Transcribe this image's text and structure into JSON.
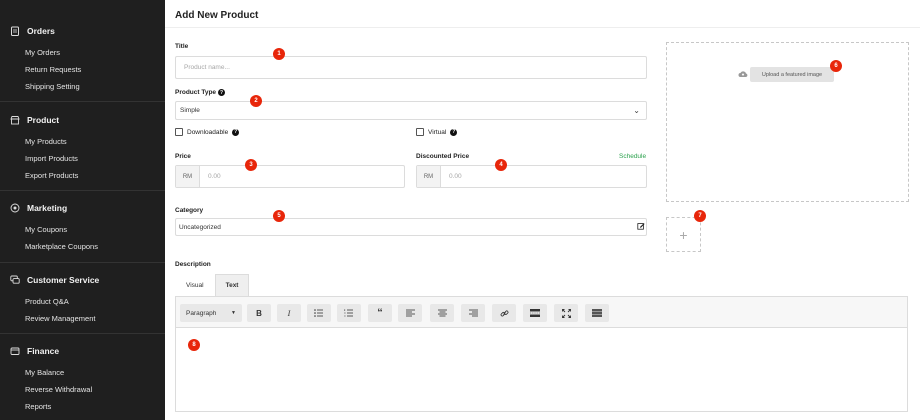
{
  "sidebar": {
    "sections": [
      {
        "title": "Orders",
        "icon": "clipboard-icon",
        "items": [
          "My Orders",
          "Return Requests",
          "Shipping Setting"
        ]
      },
      {
        "title": "Product",
        "icon": "store-icon",
        "items": [
          "My Products",
          "Import Products",
          "Export Products"
        ]
      },
      {
        "title": "Marketing",
        "icon": "target-icon",
        "items": [
          "My Coupons",
          "Marketplace Coupons"
        ]
      },
      {
        "title": "Customer Service",
        "icon": "chat-icon",
        "items": [
          "Product Q&A",
          "Review Management"
        ]
      },
      {
        "title": "Finance",
        "icon": "wallet-icon",
        "items": [
          "My Balance",
          "Reverse Withdrawal",
          "Reports"
        ]
      }
    ]
  },
  "page": {
    "title": "Add New Product"
  },
  "form": {
    "title_label": "Title",
    "title_placeholder": "Product name...",
    "type_label": "Product Type",
    "type_value": "Simple",
    "downloadable_label": "Downloadable",
    "virtual_label": "Virtual",
    "price_label": "Price",
    "currency": "RM",
    "price_placeholder": "0.00",
    "discount_label": "Discounted Price",
    "schedule_label": "Schedule",
    "discount_placeholder": "0.00",
    "category_label": "Category",
    "category_value": "Uncategorized",
    "upload_label": "Upload a featured image",
    "gallery_add": "+",
    "description_label": "Description",
    "editor_tabs": [
      "Visual",
      "Text"
    ],
    "paragraph_label": "Paragraph"
  },
  "markers": [
    "1",
    "2",
    "3",
    "4",
    "5",
    "6",
    "7",
    "8"
  ],
  "colors": {
    "sidebar_bg": "#1f1f1f",
    "marker": "#e8260a",
    "schedule": "#2ba14d"
  }
}
